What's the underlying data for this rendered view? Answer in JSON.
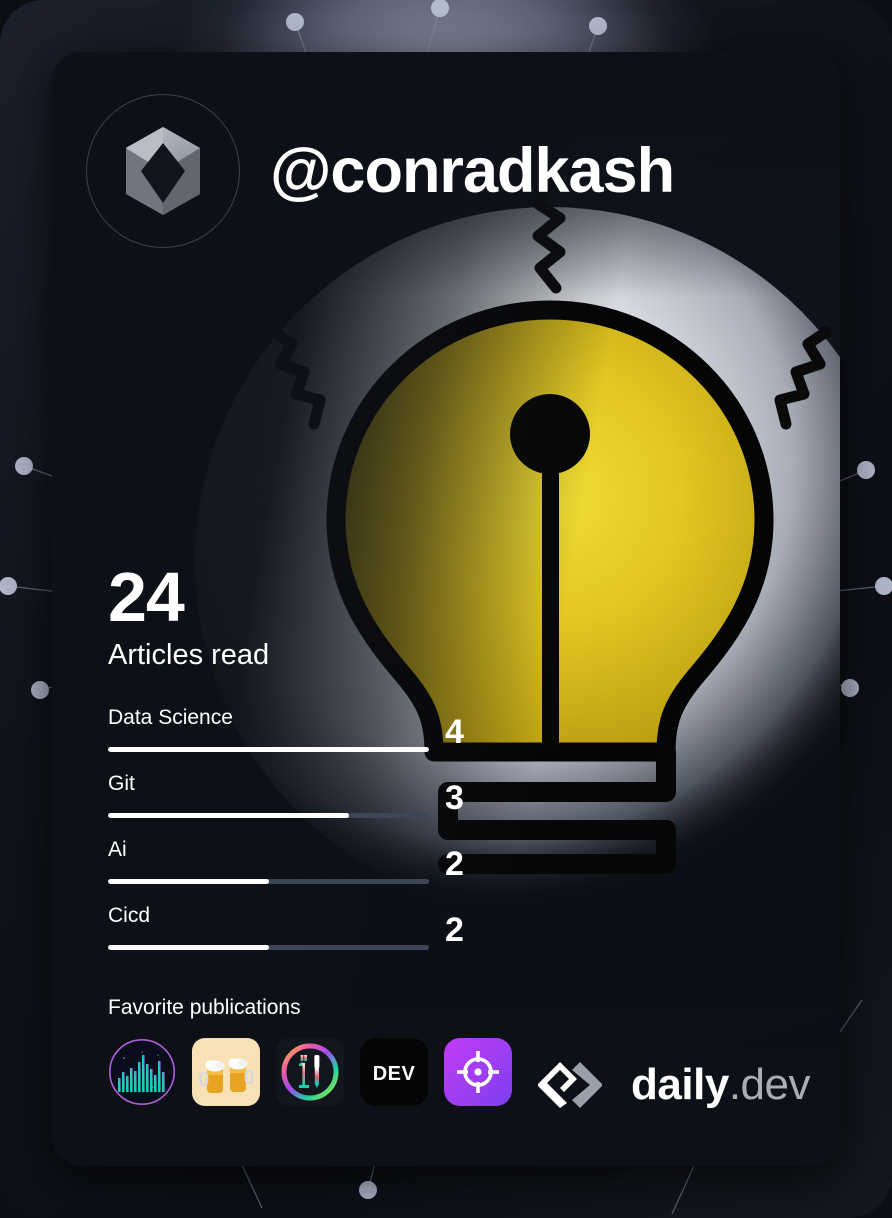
{
  "card": {
    "username": "@conradkash",
    "avatar_icon": "daily-dev-hexagon-placeholder-avatar"
  },
  "stats": {
    "articles_read_count": "24",
    "articles_read_label": "Articles read"
  },
  "tags": [
    {
      "name": "Data Science",
      "count": "4",
      "fill_percent": 100
    },
    {
      "name": "Git",
      "count": "3",
      "fill_percent": 75
    },
    {
      "name": "Ai",
      "count": "2",
      "fill_percent": 50
    },
    {
      "name": "Cicd",
      "count": "2",
      "fill_percent": 50
    }
  ],
  "publications": {
    "title": "Favorite publications",
    "items": [
      {
        "icon": "equalizer-bar-chart-circle-icon"
      },
      {
        "icon": "beer-mugs-icon"
      },
      {
        "icon": "wrench-screwdriver-rainbow-ring-icon"
      },
      {
        "icon": "dev-to-logo-icon",
        "label": "DEV"
      },
      {
        "icon": "crosshair-target-icon"
      }
    ]
  },
  "branding": {
    "logo_icon": "daily-dev-chevron-logo-icon",
    "name": "daily",
    "tld": ".dev"
  },
  "colors": {
    "card_background": "#0e1118",
    "page_background": "#11141c",
    "text_primary": "#ffffff",
    "bar_track": "#3d4656",
    "bar_fill": "#ffffff",
    "bulb_yellow": "#e0c423",
    "bulb_glow": "#c4cbdf",
    "network_node": "#b8c0d4",
    "logo_gray": "#a8adb8"
  }
}
